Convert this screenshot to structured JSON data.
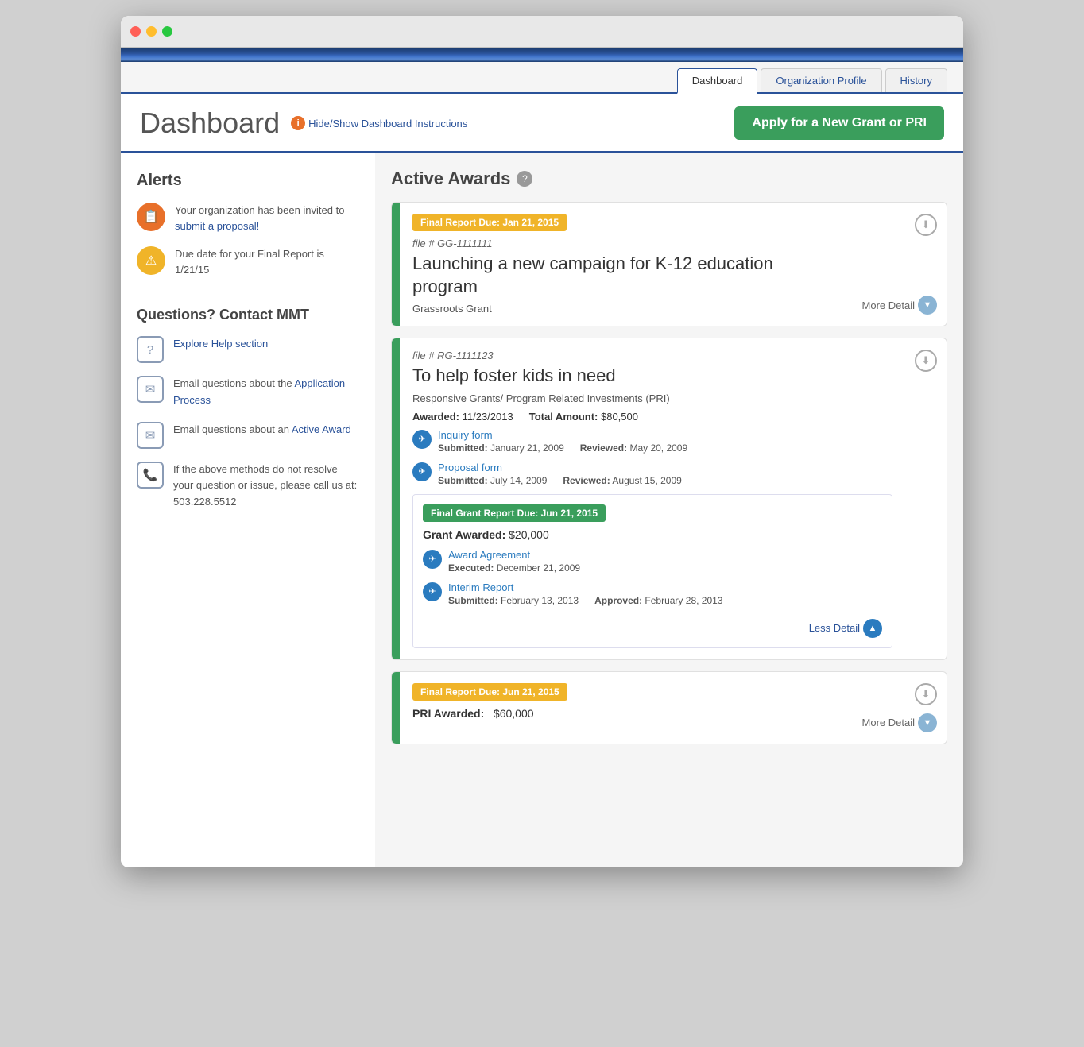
{
  "window": {
    "title": "Dashboard"
  },
  "nav": {
    "tabs": [
      {
        "id": "dashboard",
        "label": "Dashboard",
        "active": true
      },
      {
        "id": "org-profile",
        "label": "Organization Profile",
        "active": false
      },
      {
        "id": "history",
        "label": "History",
        "active": false
      }
    ]
  },
  "header": {
    "title": "Dashboard",
    "hide_show_label": "Hide/Show Dashboard Instructions",
    "apply_btn_label": "Apply for a New Grant or PRI"
  },
  "sidebar": {
    "alerts_title": "Alerts",
    "alerts": [
      {
        "icon": "📋",
        "icon_type": "red",
        "text_before": "Your organization has been invited to ",
        "link_text": "submit a proposal!",
        "text_after": ""
      },
      {
        "icon": "⚠",
        "icon_type": "yellow",
        "text": "Due date for your Final Report is 1/21/15"
      }
    ],
    "contact_title": "Questions? Contact MMT",
    "contacts": [
      {
        "icon_type": "question",
        "link_text": "Explore Help section",
        "text": ""
      },
      {
        "icon_type": "email",
        "text_before": "Email questions about the ",
        "link_text": "Application Process",
        "text_after": ""
      },
      {
        "icon_type": "email",
        "text_before": "Email questions about an ",
        "link_text": "Active Award",
        "text_after": ""
      },
      {
        "icon_type": "phone",
        "text": "If the above methods do not resolve your question or issue, please call us at: 503.228.5512"
      }
    ]
  },
  "active_awards": {
    "title": "Active Awards",
    "cards": [
      {
        "id": "card1",
        "badge": "Final Report Due: Jan 21, 2015",
        "badge_type": "yellow",
        "file_num": "file # GG-1111111",
        "title": "Launching a new campaign for K-12 education program",
        "type": "Grassroots Grant",
        "more_detail_label": "More Detail",
        "expanded": false
      },
      {
        "id": "card2",
        "badge": null,
        "file_num": "file # RG-1111123",
        "title": "To help foster kids in need",
        "type": "Responsive Grants/ Program Related Investments (PRI)",
        "awarded_label": "Awarded:",
        "awarded_date": "11/23/2013",
        "total_amount_label": "Total Amount:",
        "total_amount": "$80,500",
        "forms": [
          {
            "link_text": "Inquiry form",
            "submitted_label": "Submitted:",
            "submitted_date": "January 21, 2009",
            "reviewed_label": "Reviewed:",
            "reviewed_date": "May 20, 2009"
          },
          {
            "link_text": "Proposal form",
            "submitted_label": "Submitted:",
            "submitted_date": "July 14, 2009",
            "reviewed_label": "Reviewed:",
            "reviewed_date": "August 15, 2009"
          }
        ],
        "nested": {
          "badge": "Final Grant Report Due: Jun 21, 2015",
          "badge_type": "green",
          "grant_awarded_label": "Grant Awarded:",
          "grant_awarded_amount": "$20,000",
          "items": [
            {
              "link_text": "Award Agreement",
              "executed_label": "Executed:",
              "executed_date": "December 21, 2009"
            },
            {
              "link_text": "Interim Report",
              "submitted_label": "Submitted:",
              "submitted_date": "February 13, 2013",
              "approved_label": "Approved:",
              "approved_date": "February 28, 2013"
            }
          ],
          "less_detail_label": "Less Detail"
        },
        "expanded": true
      },
      {
        "id": "card3",
        "badge": "Final Report Due: Jun 21, 2015",
        "badge_type": "yellow",
        "pri_awarded_label": "PRI Awarded:",
        "pri_awarded_amount": "$60,000",
        "more_detail_label": "More Detail",
        "expanded": false,
        "partial": true
      }
    ]
  }
}
